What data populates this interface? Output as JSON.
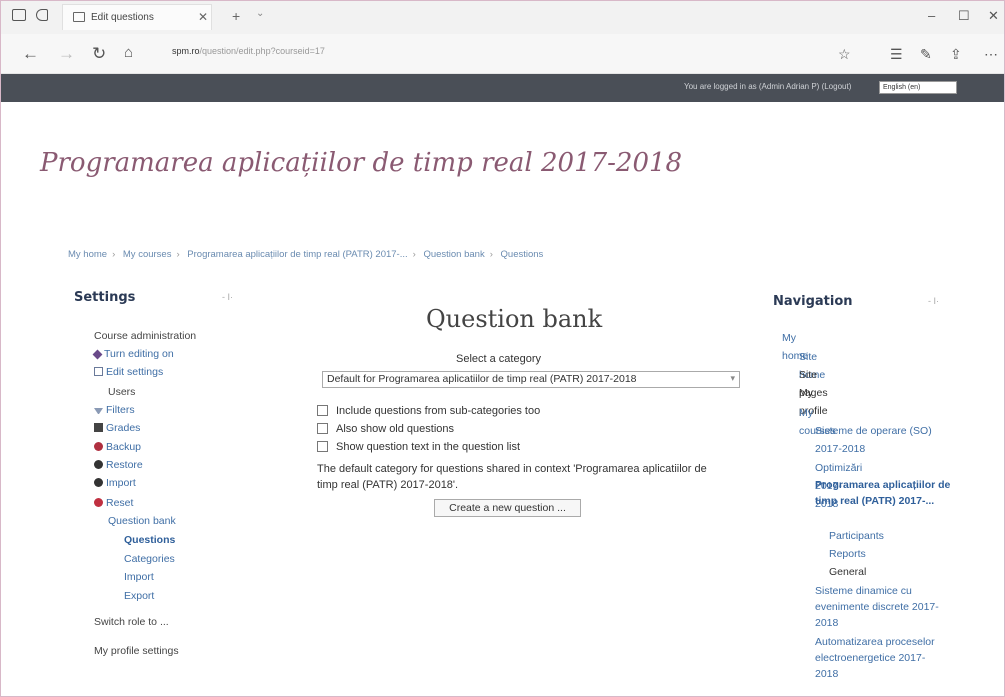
{
  "browser": {
    "tab_title": "Edit questions",
    "url_host": "spm.ro",
    "url_rest": "/question/edit.php?courseid=17"
  },
  "header": {
    "login_info": "You are logged in as (Admin Adrian P) (Logout)",
    "language": "English (en)"
  },
  "course": {
    "title": "Programarea aplicațiilor de timp real 2017-2018"
  },
  "breadcrumb": [
    "My home",
    "My courses",
    "Programarea aplicațiilor de timp real (PATR) 2017-...",
    "Question bank",
    "Questions"
  ],
  "settings": {
    "title": "Settings",
    "control": "- I·",
    "items": [
      {
        "label": "Course administration",
        "level": 0,
        "icon": "none",
        "style": "dark"
      },
      {
        "label": "Turn editing on",
        "level": 1,
        "icon": "pencil-icon"
      },
      {
        "label": "Edit settings",
        "level": 1,
        "icon": "settings-icon"
      },
      {
        "label": "Users",
        "level": 1,
        "icon": "none",
        "style": "dark"
      },
      {
        "label": "Filters",
        "level": 1,
        "icon": "filter-icon"
      },
      {
        "label": "Grades",
        "level": 1,
        "icon": "grades-icon"
      },
      {
        "label": "Backup",
        "level": 1,
        "icon": "backup-icon"
      },
      {
        "label": "Restore",
        "level": 1,
        "icon": "restore-icon"
      },
      {
        "label": "Import",
        "level": 1,
        "icon": "import-icon"
      },
      {
        "label": "Reset",
        "level": 1,
        "icon": "reset-icon"
      },
      {
        "label": "Question bank",
        "level": 1,
        "icon": "none"
      },
      {
        "label": "Questions",
        "level": 2,
        "icon": "none",
        "style": "bold"
      },
      {
        "label": "Categories",
        "level": 2,
        "icon": "none"
      },
      {
        "label": "Import",
        "level": 2,
        "icon": "none"
      },
      {
        "label": "Export",
        "level": 2,
        "icon": "none"
      },
      {
        "label": "Switch role to ...",
        "level": 0,
        "icon": "none",
        "style": "dark"
      },
      {
        "label": "My profile settings",
        "level": 0,
        "icon": "none",
        "style": "dark"
      }
    ]
  },
  "main": {
    "title": "Question bank",
    "select_label": "Select a category",
    "selected_category": "Default for Programarea aplicatiilor de timp real (PATR) 2017-2018",
    "checkboxes": [
      "Include questions from sub-categories too",
      "Also show old questions",
      "Show question text in the question list"
    ],
    "info": "The default category for questions shared in context 'Programarea aplicatiilor de timp real (PATR) 2017-2018'.",
    "create_button": "Create a new question ..."
  },
  "navigation": {
    "title": "Navigation",
    "control": "- I·",
    "items": [
      {
        "label": "My home",
        "style": "link"
      },
      {
        "label": "Site home",
        "style": "link"
      },
      {
        "label": "Site pages",
        "style": "dark"
      },
      {
        "label": "My profile",
        "style": "dark"
      },
      {
        "label": "My courses",
        "style": "link"
      },
      {
        "label": "Sisteme de operare (SO) 2017-2018",
        "style": "link"
      },
      {
        "label": "Optimizări 2017-2018",
        "style": "link"
      },
      {
        "label": "Programarea aplicațiilor de timp real (PATR) 2017-...",
        "style": "bold"
      },
      {
        "label": "Participants",
        "style": "link"
      },
      {
        "label": "Reports",
        "style": "link"
      },
      {
        "label": "General",
        "style": "dark"
      },
      {
        "label": "Sisteme dinamice cu evenimente discrete 2017-2018",
        "style": "link"
      },
      {
        "label": "Automatizarea proceselor electroenergetice 2017-2018",
        "style": "link"
      }
    ]
  }
}
